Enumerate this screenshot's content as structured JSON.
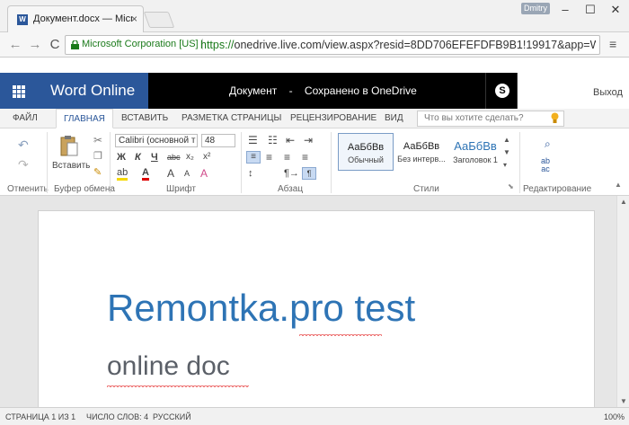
{
  "browser": {
    "tab_title": "Документ.docx — Microso",
    "tab_close": "×",
    "user_badge": "Dmitry",
    "win_min": "–",
    "win_max": "☐",
    "win_close": "✕",
    "back": "←",
    "forward": "→",
    "reload": "C",
    "ev_label": "Microsoft Corporation [US]",
    "url_scheme": "https://",
    "url_rest": "onedrive.live.com/view.aspx?resid=8DD706EFEFDFB9B1!19917&app=W",
    "menu": "≡"
  },
  "word": {
    "brand": "Word Online",
    "doc_name": "Документ",
    "doc_sep": "-",
    "save_status": "Сохранено в OneDrive",
    "sign_out": "Выход",
    "brand_color": "#2b579a"
  },
  "ribbon_tabs": {
    "file": "ФАЙЛ",
    "home": "ГЛАВНАЯ",
    "insert": "ВСТАВИТЬ",
    "layout": "РАЗМЕТКА СТРАНИЦЫ",
    "review": "РЕЦЕНЗИРОВАНИЕ",
    "view": "ВИД",
    "tell_me_placeholder": "Что вы хотите сделать?"
  },
  "ribbon": {
    "undo_group": "Отменить",
    "clipboard_group": "Буфер обмена",
    "paste_label": "Вставить",
    "font_group": "Шрифт",
    "font_name": "Calibri (основной т",
    "font_size": "48",
    "paragraph_group": "Абзац",
    "styles_group": "Стили",
    "editing_group": "Редактирование",
    "bold": "Ж",
    "italic": "К",
    "underline": "Ч",
    "strike": "abc",
    "sub": "x₂",
    "sup": "x²",
    "grow": "A",
    "shrink": "A",
    "clear": "A",
    "styles": [
      {
        "sample": "АаБбВв",
        "name": "Обычный"
      },
      {
        "sample": "АаБбВв",
        "name": "Без интерв..."
      },
      {
        "sample": "АаБбВв",
        "name": "Заголовок 1"
      }
    ]
  },
  "document": {
    "heading": "Remontka.pro test",
    "subheading": "online doc",
    "heading_color": "#2e74b5"
  },
  "status": {
    "page": "СТРАНИЦА 1 ИЗ 1",
    "words": "ЧИСЛО СЛОВ: 4",
    "language": "РУССКИЙ",
    "zoom": "100%"
  }
}
